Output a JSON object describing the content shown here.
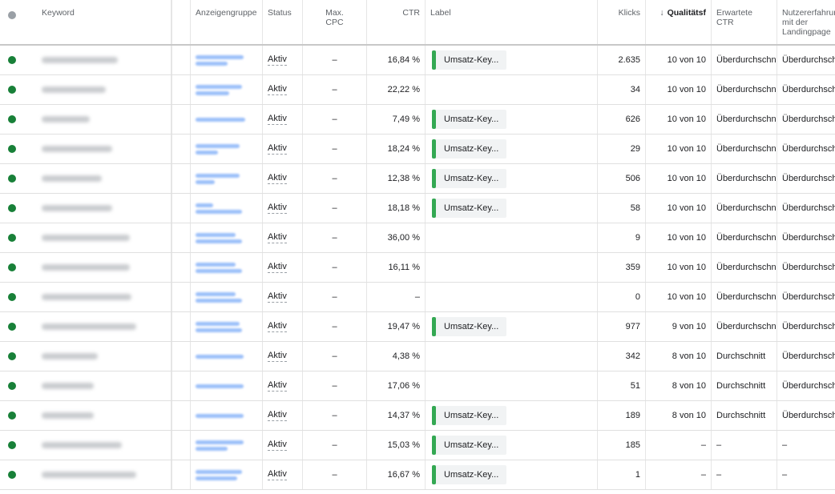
{
  "header": {
    "keyword": "Keyword",
    "ad_group": "Anzeigengruppe",
    "status": "Status",
    "max_cpc": "Max. CPC",
    "ctr": "CTR",
    "label": "Label",
    "clicks": "Klicks",
    "quality_sort_arrow": "↓",
    "quality": "Qualitätsf",
    "expected_ctr": "Erwartete CTR",
    "landing_page": "Nutzererfahrung mit der Landingpage"
  },
  "colors": {
    "status_dot": "#188038",
    "label_bar": "#34a853",
    "link_blur": "#8ab4f8"
  },
  "rows": [
    {
      "status": "Aktiv",
      "cpc": "–",
      "ctr": "16,84 %",
      "label": "Umsatz-Key...",
      "clicks": "2.635",
      "qs": "10 von 10",
      "exp_ctr": "Überdurchschni",
      "lp": "Überdurchschn"
    },
    {
      "status": "Aktiv",
      "cpc": "–",
      "ctr": "22,22 %",
      "label": "",
      "clicks": "34",
      "qs": "10 von 10",
      "exp_ctr": "Überdurchschni",
      "lp": "Überdurchschn"
    },
    {
      "status": "Aktiv",
      "cpc": "–",
      "ctr": "7,49 %",
      "label": "Umsatz-Key...",
      "clicks": "626",
      "qs": "10 von 10",
      "exp_ctr": "Überdurchschni",
      "lp": "Überdurchschn"
    },
    {
      "status": "Aktiv",
      "cpc": "–",
      "ctr": "18,24 %",
      "label": "Umsatz-Key...",
      "clicks": "29",
      "qs": "10 von 10",
      "exp_ctr": "Überdurchschni",
      "lp": "Überdurchschn"
    },
    {
      "status": "Aktiv",
      "cpc": "–",
      "ctr": "12,38 %",
      "label": "Umsatz-Key...",
      "clicks": "506",
      "qs": "10 von 10",
      "exp_ctr": "Überdurchschni",
      "lp": "Überdurchschn"
    },
    {
      "status": "Aktiv",
      "cpc": "–",
      "ctr": "18,18 %",
      "label": "Umsatz-Key...",
      "clicks": "58",
      "qs": "10 von 10",
      "exp_ctr": "Überdurchschni",
      "lp": "Überdurchschn"
    },
    {
      "status": "Aktiv",
      "cpc": "–",
      "ctr": "36,00 %",
      "label": "",
      "clicks": "9",
      "qs": "10 von 10",
      "exp_ctr": "Überdurchschni",
      "lp": "Überdurchschn"
    },
    {
      "status": "Aktiv",
      "cpc": "–",
      "ctr": "16,11 %",
      "label": "",
      "clicks": "359",
      "qs": "10 von 10",
      "exp_ctr": "Überdurchschni",
      "lp": "Überdurchschn"
    },
    {
      "status": "Aktiv",
      "cpc": "–",
      "ctr": "–",
      "label": "",
      "clicks": "0",
      "qs": "10 von 10",
      "exp_ctr": "Überdurchschni",
      "lp": "Überdurchschn"
    },
    {
      "status": "Aktiv",
      "cpc": "–",
      "ctr": "19,47 %",
      "label": "Umsatz-Key...",
      "clicks": "977",
      "qs": "9 von 10",
      "exp_ctr": "Überdurchschni",
      "lp": "Überdurchschn"
    },
    {
      "status": "Aktiv",
      "cpc": "–",
      "ctr": "4,38 %",
      "label": "",
      "clicks": "342",
      "qs": "8 von 10",
      "exp_ctr": "Durchschnitt",
      "lp": "Überdurchschn"
    },
    {
      "status": "Aktiv",
      "cpc": "–",
      "ctr": "17,06 %",
      "label": "",
      "clicks": "51",
      "qs": "8 von 10",
      "exp_ctr": "Durchschnitt",
      "lp": "Überdurchschn"
    },
    {
      "status": "Aktiv",
      "cpc": "–",
      "ctr": "14,37 %",
      "label": "Umsatz-Key...",
      "clicks": "189",
      "qs": "8 von 10",
      "exp_ctr": "Durchschnitt",
      "lp": "Überdurchschn"
    },
    {
      "status": "Aktiv",
      "cpc": "–",
      "ctr": "15,03 %",
      "label": "Umsatz-Key...",
      "clicks": "185",
      "qs": "–",
      "exp_ctr": "–",
      "lp": "–"
    },
    {
      "status": "Aktiv",
      "cpc": "–",
      "ctr": "16,67 %",
      "label": "Umsatz-Key...",
      "clicks": "1",
      "qs": "–",
      "exp_ctr": "–",
      "lp": "–"
    }
  ]
}
